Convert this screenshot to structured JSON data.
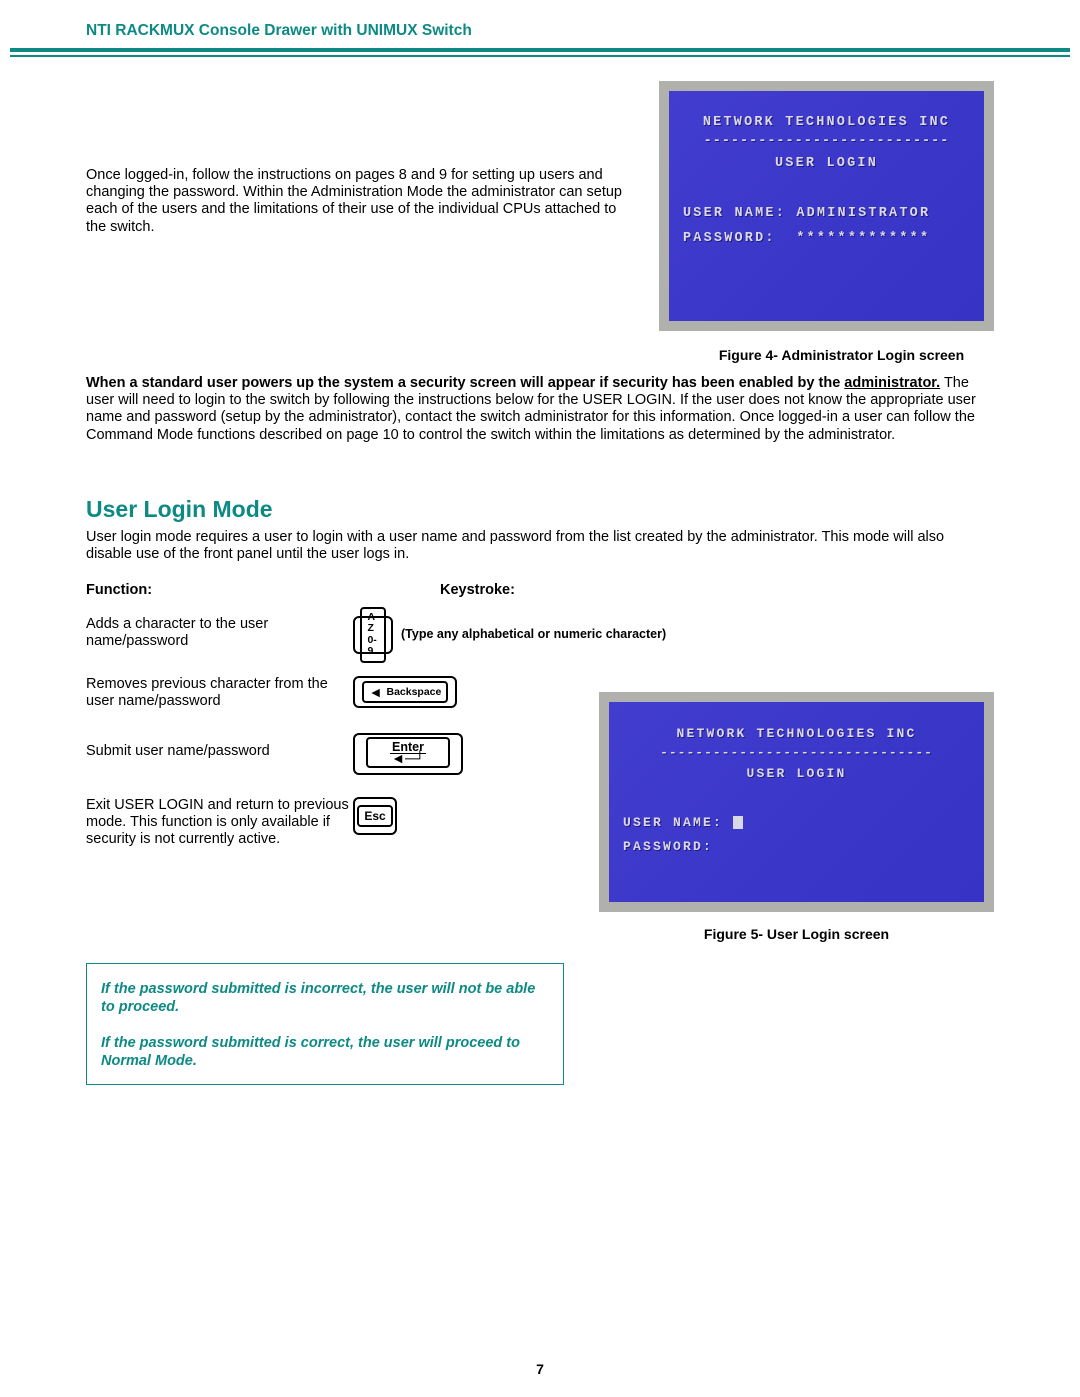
{
  "header": {
    "title": "NTI RACKMUX Console Drawer with UNIMUX Switch"
  },
  "intro": {
    "text": "Once logged-in, follow the instructions on pages 8 and 9 for setting up users and changing the password. Within the Administration Mode the administrator can setup each of the users and the limitations of their use of the individual CPUs attached to the switch."
  },
  "fig4": {
    "caption": "Figure 4- Administrator Login screen",
    "company": "NETWORK TECHNOLOGIES INC",
    "subtitle": "USER LOGIN",
    "user_label": "USER NAME:",
    "user_value": "ADMINISTRATOR",
    "pass_label": "PASSWORD:",
    "pass_value": "*************"
  },
  "security_para": {
    "bold_lead": "When a standard user powers up the system a security screen will appear if security has been enabled by the ",
    "bold_admin_underlined": "administrator.",
    "rest": "   The user will need to login to the switch by following the instructions below for the USER LOGIN.    If the user does not know the appropriate user name and password (setup by the administrator), contact the switch administrator for this information.   Once logged-in a user can follow the Command Mode functions described on page 10 to control the switch within the limitations as determined by the administrator."
  },
  "section": {
    "title": "User Login Mode",
    "para": "User login mode requires a user to login with a user name and password from the list created by the administrator.  This mode will also disable use of the front panel until the user logs in."
  },
  "fk": {
    "function_header": "Function:",
    "keystroke_header": "Keystroke:",
    "rows": [
      {
        "func": "Adds a character to the user name/password",
        "key_top": "A-Z",
        "key_bottom": "0-9",
        "note": "(Type any alphabetical or numeric character)"
      },
      {
        "func": "Removes previous character from the user name/password",
        "key_label": "Backspace"
      },
      {
        "func": "Submit user name/password",
        "key_label": "Enter"
      },
      {
        "func": "Exit USER LOGIN and return to previous mode. This function is only available if security is not currently active.",
        "key_label": "Esc"
      }
    ]
  },
  "fig5": {
    "caption": "Figure 5- User Login screen",
    "company": "NETWORK TECHNOLOGIES INC",
    "subtitle": "USER LOGIN",
    "user_label": "USER NAME:",
    "pass_label": "PASSWORD:"
  },
  "callout": {
    "p1": "If the password submitted is incorrect, the user will not be able to proceed.",
    "p2": "If the password submitted is correct, the user will proceed to Normal Mode."
  },
  "page_number": "7"
}
